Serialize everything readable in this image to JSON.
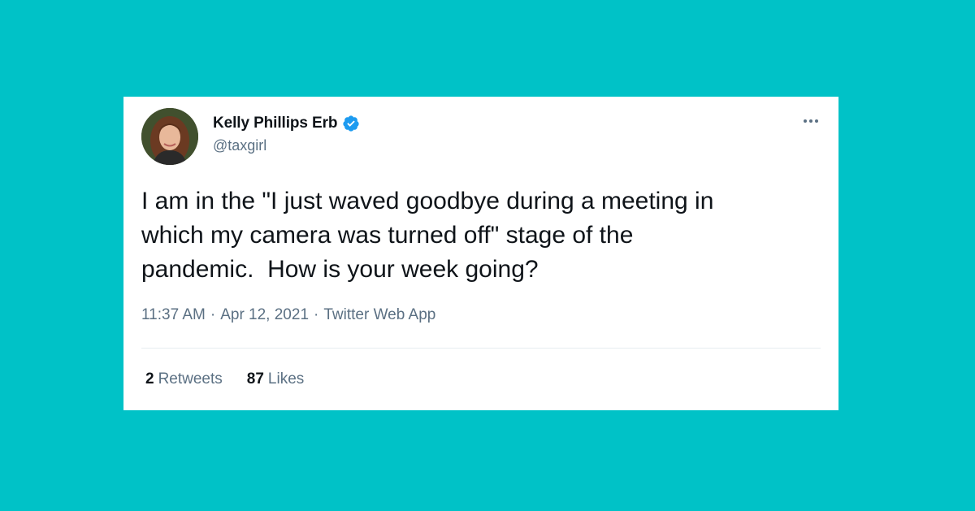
{
  "colors": {
    "background": "#00c2c7",
    "card": "#ffffff",
    "verified_badge": "#1d9bf0",
    "secondary_text": "#5b7083",
    "primary_text": "#0f1419"
  },
  "tweet": {
    "author": {
      "display_name": "Kelly Phillips Erb",
      "handle": "@taxgirl",
      "verified": true,
      "verified_icon": "verified-badge-icon",
      "avatar": "avatar-photo"
    },
    "more_icon": "more-options-icon",
    "text": "I am in the \"I just waved goodbye during a meeting in\nwhich my camera was turned off\" stage of the\npandemic.  How is your week going?",
    "time": "11:37 AM",
    "date": "Apr 12, 2021",
    "source": "Twitter Web App",
    "separator": "·",
    "retweets": {
      "count": "2",
      "label": "Retweets"
    },
    "likes": {
      "count": "87",
      "label": "Likes"
    }
  }
}
